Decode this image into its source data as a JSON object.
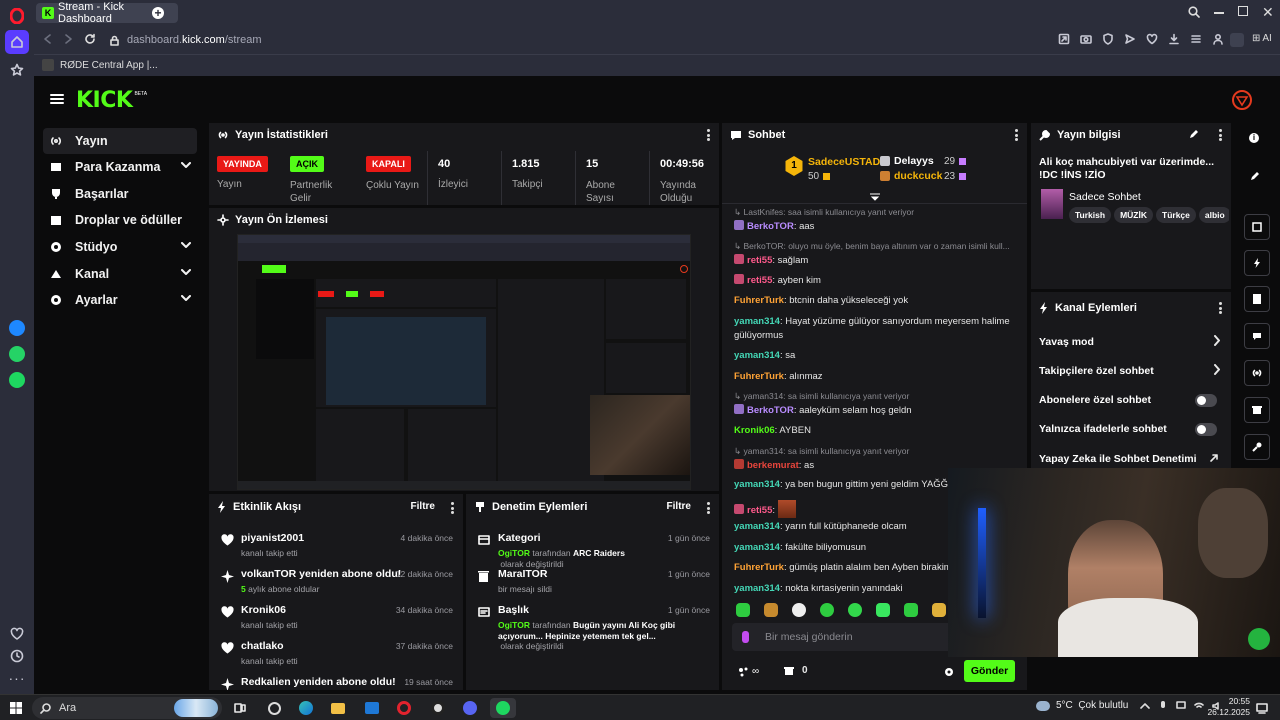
{
  "browser": {
    "tab_title": "Stream - Kick Dashboard",
    "url_prefix": "dashboard.",
    "url_domain": "kick.com",
    "url_path": "/stream",
    "bookmark": "RØDE Central App |...",
    "ai_label": "AI"
  },
  "brand": {
    "logo": "KICK",
    "beta": "BETA"
  },
  "nav": [
    {
      "label": "Yayın"
    },
    {
      "label": "Para Kazanma"
    },
    {
      "label": "Başarılar"
    },
    {
      "label": "Droplar ve ödüller"
    },
    {
      "label": "Stüdyo"
    },
    {
      "label": "Kanal"
    },
    {
      "label": "Ayarlar"
    }
  ],
  "stats": {
    "title": "Yayın İstatistikleri",
    "items": [
      {
        "value": "YAYINDA",
        "label": "Yayın",
        "style": "red"
      },
      {
        "value": "AÇIK",
        "label": "Partnerlik Gelir",
        "style": "green"
      },
      {
        "value": "KAPALI",
        "label": "Çoklu Yayın",
        "style": "red"
      },
      {
        "value": "40",
        "label": "İzleyici"
      },
      {
        "value": "1.815",
        "label": "Takipçi"
      },
      {
        "value": "15",
        "label": "Abone Sayısı"
      },
      {
        "value": "00:49:56",
        "label": "Yayında Olduğu"
      }
    ]
  },
  "preview": {
    "title": "Yayın Ön İzlemesi"
  },
  "activity": {
    "title": "Etkinlik Akışı",
    "filter": "Filtre",
    "items": [
      {
        "title": "piyanist2001",
        "sub": "kanalı takip etti",
        "time": "4 dakika önce",
        "icon": "heart"
      },
      {
        "title": "volkanTOR yeniden abone oldu!",
        "sub_num": "5",
        "sub": " aylık abone oldular",
        "time": "12 dakika önce",
        "icon": "sparkle"
      },
      {
        "title": "Kronik06",
        "sub": "kanalı takip etti",
        "time": "34 dakika önce",
        "icon": "heart"
      },
      {
        "title": "chatlako",
        "sub": "kanalı takip etti",
        "time": "37 dakika önce",
        "icon": "heart"
      },
      {
        "title": "Redkalien yeniden abone oldu!",
        "sub": "",
        "time": "19 saat önce",
        "icon": "sparkle"
      }
    ]
  },
  "moderation": {
    "title": "Denetim Eylemleri",
    "filter": "Filtre",
    "items": [
      {
        "title": "Kategori",
        "user": "OgiTOR",
        "mid": " tarafından ",
        "val": "ARC Raiders",
        "end": " olarak değiştirildi",
        "time": "1 gün önce",
        "icon": "category"
      },
      {
        "title": "MaraITOR",
        "plain": "bir mesajı sildi",
        "time": "1 gün önce",
        "icon": "trash"
      },
      {
        "title": "Başlık",
        "user": "OgiTOR",
        "mid": " tarafından ",
        "val": "Bugün yayını Ali Koç gibi açıyorum... Hepinize yetemem tek gel...",
        "end": " olarak değiştirildi",
        "time": "1 gün önce",
        "icon": "title"
      }
    ]
  },
  "chat": {
    "title": "Sohbet",
    "top": [
      {
        "name": "SadeceUSTAD",
        "count": "50",
        "rank": "1"
      },
      {
        "name": "Delayys",
        "count": "29"
      },
      {
        "name": "duckcuck",
        "count": "23"
      }
    ],
    "messages": [
      {
        "reply": "LastKnifes: saa isimli kullanıcıya yanıt veriyor",
        "user": "BerkoTOR",
        "color": "#b98cff",
        "text": "aas",
        "badge": true
      },
      {
        "reply": "BerkoTOR: oluyo mu öyle, benim baya altınım var o zaman isimli kull...",
        "user": "reti55",
        "color": "#ff5a8c",
        "text": "sağlam",
        "badge": true
      },
      {
        "user": "reti55",
        "color": "#ff5a8c",
        "text": "ayben kim",
        "badge": true
      },
      {
        "user": "FuhrerTurk",
        "color": "#ffa336",
        "text": "btcnin daha yükseleceği yok"
      },
      {
        "user": "yaman314",
        "color": "#44d7b6",
        "text": "Hayat yüzüme gülüyor sanıyordum meyersem halime"
      },
      {
        "cont": "gülüyormus"
      },
      {
        "user": "yaman314",
        "color": "#44d7b6",
        "text": "sa"
      },
      {
        "user": "FuhrerTurk",
        "color": "#ffa336",
        "text": "alınmaz"
      },
      {
        "reply": "yaman314: sa isimli kullanıcıya yanıt veriyor",
        "user": "BerkoTOR",
        "color": "#b98cff",
        "text": "aaleyküm selam hoş geldn",
        "badge": true
      },
      {
        "user": "Kronik06",
        "color": "#53fc18",
        "text": "AYBEN"
      },
      {
        "reply": "yaman314: sa isimli kullanıcıya yanıt veriyor",
        "user": "berkemurat",
        "color": "#e8453c",
        "text": "as",
        "badge": true
      },
      {
        "user": "yaman314",
        "color": "#44d7b6",
        "text": "ya ben bugun gittim yeni geldim YAĞĞĞ"
      },
      {
        "user": "reti55",
        "color": "#ff5a8c",
        "text": "",
        "badge": true,
        "emote": true
      },
      {
        "user": "yaman314",
        "color": "#44d7b6",
        "text": "yarın full kütüphanede olcam"
      },
      {
        "user": "yaman314",
        "color": "#44d7b6",
        "text": "fakülte biliyomusun"
      },
      {
        "user": "FuhrerTurk",
        "color": "#ffa336",
        "text": "gümüş platin alalım ben Ayben birakim"
      },
      {
        "user": "yaman314",
        "color": "#44d7b6",
        "text": "nokta kırtasiyenin yanındaki"
      }
    ],
    "input_placeholder": "Bir mesaj gönderin",
    "viewers_count": "0",
    "send": "Gönder"
  },
  "stream_info": {
    "title": "Yayın bilgisi",
    "stream_title": "Ali koç mahcubiyeti var üzerimde... !DC !İNS !ZİO",
    "category": "Sadece Sohbet",
    "tags": [
      "Turkish",
      "MÜZİK",
      "Türkçe",
      "albio"
    ]
  },
  "channel_actions": {
    "title": "Kanal Eylemleri",
    "items": [
      {
        "label": "Yavaş mod",
        "kind": "chevron"
      },
      {
        "label": "Takipçilere özel sohbet",
        "kind": "chevron"
      },
      {
        "label": "Abonelere özel sohbet",
        "kind": "toggle"
      },
      {
        "label": "Yalnızca ifadelerle sohbet",
        "kind": "toggle"
      },
      {
        "label": "Yapay Zeka ile Sohbet Denetimi",
        "kind": "link"
      }
    ]
  },
  "taskbar": {
    "search": "Ara",
    "weather": "5°C  Çok bulutlu",
    "time": "20:55",
    "date": "26.12.2025"
  },
  "colors": {
    "kick_green": "#53fc18",
    "live_red": "#e91916",
    "panel": "#18181b",
    "bg": "#0b0b0c"
  }
}
